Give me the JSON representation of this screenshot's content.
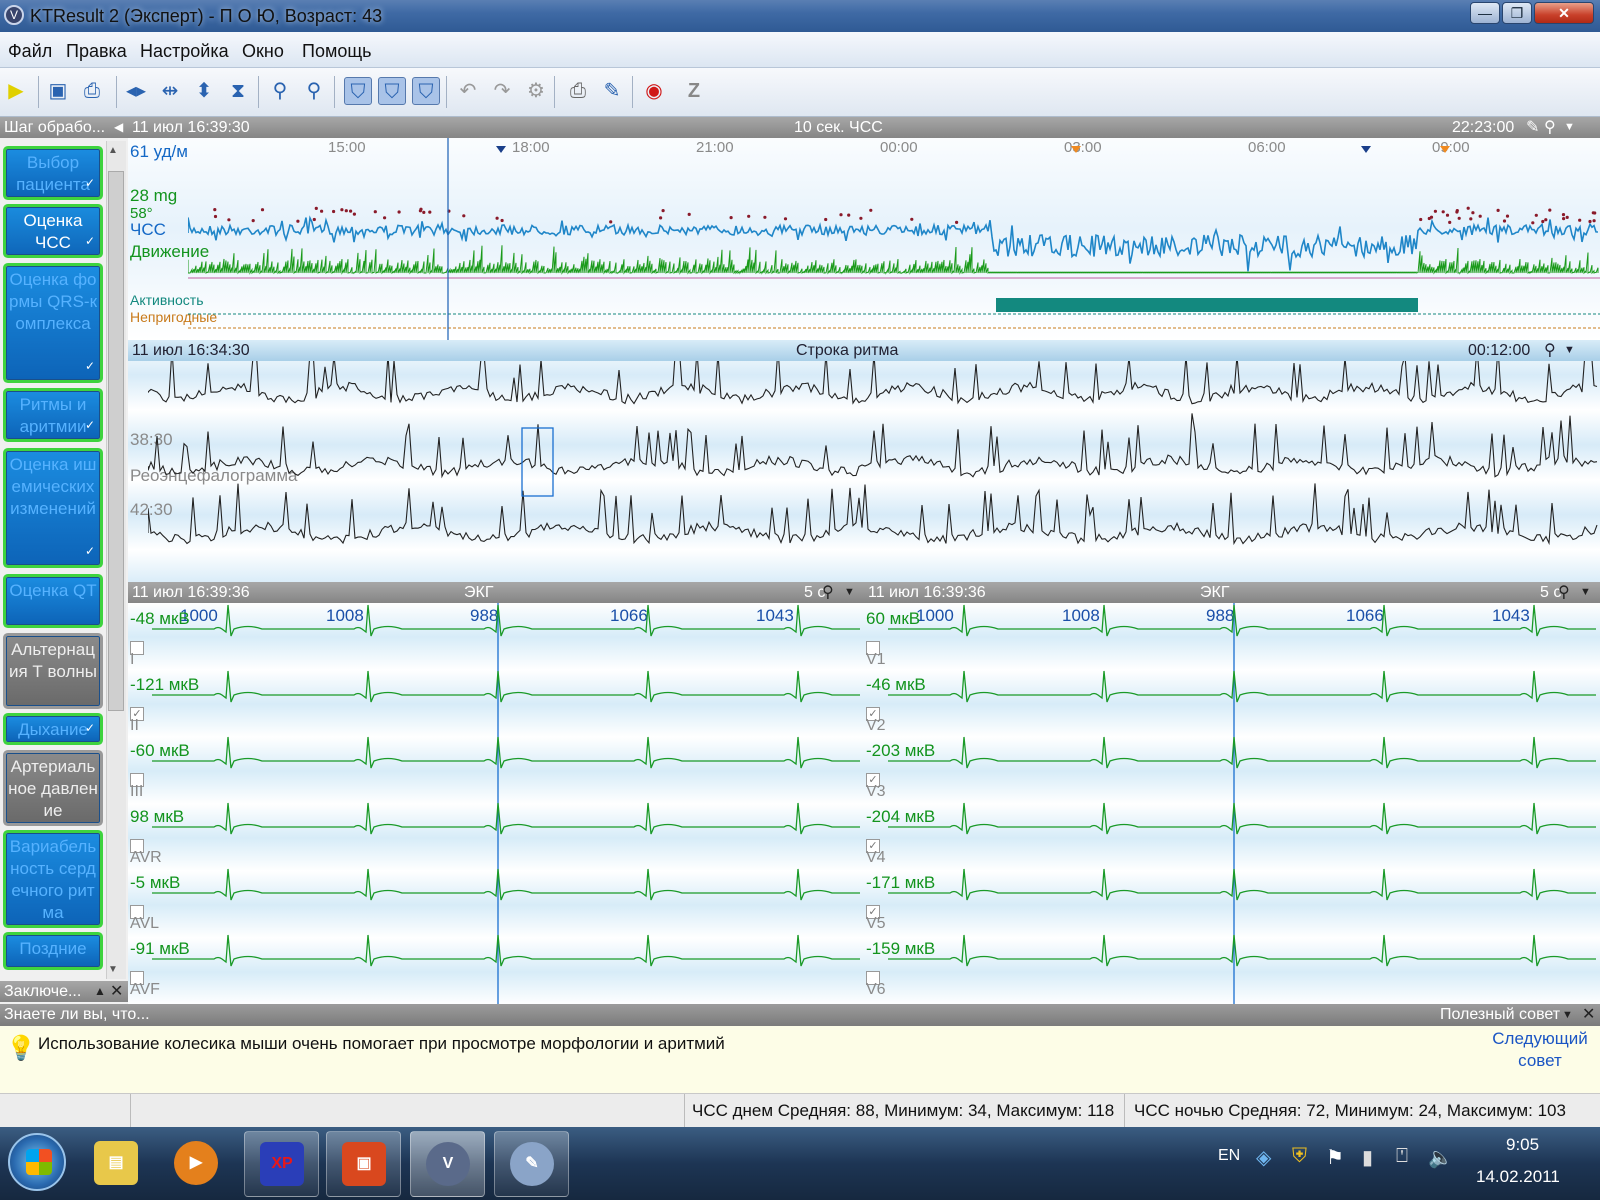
{
  "window": {
    "title": "KTResult 2 (Эксперт)  - П О Ю,  Возраст: 43",
    "minimize": "—",
    "maximize": "❐",
    "close": "✕"
  },
  "menu": [
    "Файл",
    "Правка",
    "Настройка",
    "Окно",
    "Помощь"
  ],
  "toolbar": {
    "icons": [
      "play-icon",
      "save-icon",
      "print-preview-icon",
      "zoom-horizontal-icon",
      "fit-horizontal-icon",
      "zoom-vertical-icon",
      "fit-vertical-icon",
      "filter-icon",
      "filter-2-icon",
      "filter-active-1-icon",
      "filter-active-2-icon",
      "filter-active-3-icon",
      "undo-icon",
      "redo-icon",
      "settings-icon",
      "printer-icon",
      "report-icon",
      "stop-icon",
      "z-icon"
    ],
    "z_label": "Z"
  },
  "left_panel": {
    "header": "Шаг обрабо...",
    "steps": [
      {
        "label": "Выбор пациента",
        "checked": true
      },
      {
        "label": "Оценка ЧСС",
        "checked": true
      },
      {
        "label": "Оценка формы QRS-комплекса",
        "checked": true
      },
      {
        "label": "Ритмы и аритмии",
        "checked": true
      },
      {
        "label": "Оценка ишемических изменений",
        "checked": true
      },
      {
        "label": "Оценка QT",
        "checked": false
      },
      {
        "label": "Альтернация Т волны",
        "checked": false
      },
      {
        "label": "Дыхание",
        "checked": true
      },
      {
        "label": "Артериальное давление",
        "checked": false
      },
      {
        "label": "Вариабельность сердечного ритма",
        "checked": false
      },
      {
        "label": "Поздние",
        "checked": false
      }
    ],
    "footer": "Заключе..."
  },
  "trend": {
    "header_left": "11 июл 16:39:30",
    "header_center": "10 сек. ЧСС",
    "header_right": "22:23:00",
    "times": [
      "15:00",
      "18:00",
      "21:00",
      "00:00",
      "03:00",
      "06:00",
      "09:00"
    ],
    "hr_value": "61 уд/м",
    "mg": "28 mg",
    "deg": "58°",
    "chss": "ЧСС",
    "movement": "Движение",
    "activity": "Активность",
    "unusable": "Непригодные",
    "colors": {
      "hr": "#1f86c8",
      "movement": "#1a9a1a",
      "activity": "#13897f",
      "unusable": "#c87a1a"
    }
  },
  "rhythm": {
    "header_left": "11 июл 16:34:30",
    "header_center": "Строка ритма",
    "header_right": "00:12:00",
    "row_times": [
      "38:30",
      "42:30"
    ],
    "overlay": "Реоэнцефалограмма"
  },
  "ecg_left": {
    "header_left": "11 июл 16:39:36",
    "header_center": "ЭКГ",
    "header_right": "5 с",
    "rr": [
      "1000",
      "1008",
      "988",
      "1066",
      "1043"
    ],
    "leads": [
      {
        "amp": "-48 мкВ",
        "name": "I",
        "checked": false
      },
      {
        "amp": "-121 мкВ",
        "name": "II",
        "checked": true
      },
      {
        "amp": "-60 мкВ",
        "name": "III",
        "checked": false
      },
      {
        "amp": "98 мкВ",
        "name": "AVR",
        "checked": false
      },
      {
        "amp": "-5 мкВ",
        "name": "AVL",
        "checked": false
      },
      {
        "amp": "-91 мкВ",
        "name": "AVF",
        "checked": false
      }
    ]
  },
  "ecg_right": {
    "header_left": "11 июл 16:39:36",
    "header_center": "ЭКГ",
    "header_right": "5 с",
    "rr": [
      "1000",
      "1008",
      "988",
      "1066",
      "1043"
    ],
    "leads": [
      {
        "amp": "60 мкВ",
        "name": "V1",
        "checked": false
      },
      {
        "amp": "-46 мкВ",
        "name": "V2",
        "checked": true
      },
      {
        "amp": "-203 мкВ",
        "name": "V3",
        "checked": true
      },
      {
        "amp": "-204 мкВ",
        "name": "V4",
        "checked": true
      },
      {
        "amp": "-171 мкВ",
        "name": "V5",
        "checked": true
      },
      {
        "amp": "-159 мкВ",
        "name": "V6",
        "checked": false
      }
    ]
  },
  "tips": {
    "header_left": "Знаете ли вы, что...",
    "header_right": "Полезный совет",
    "text": "Использование колесика мыши очень помогает при просмотре морфологии и аритмий",
    "next_line1": "Следующий",
    "next_line2": "совет"
  },
  "status": {
    "day": "ЧСС днем Средняя: 88, Минимум: 34,  Максимум: 118",
    "night": "ЧСС ночью Средняя: 72, Минимум: 24,  Максимум: 103"
  },
  "taskbar": {
    "lang": "EN",
    "time": "9:05",
    "date": "14.02.2011",
    "apps": [
      "explorer-icon",
      "media-player-icon",
      "floppy-xp-icon",
      "powerpoint-icon",
      "ktresult-icon",
      "paint-icon"
    ],
    "xp_label": "XP"
  }
}
